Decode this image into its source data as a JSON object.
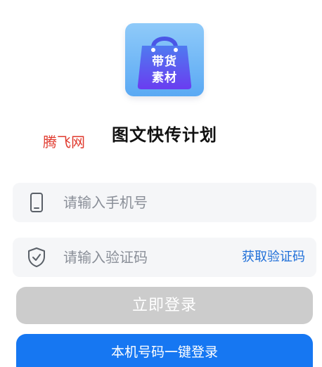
{
  "logo": {
    "line1": "带货",
    "line2": "素材"
  },
  "app_title": "图文快传计划",
  "watermark": "腾飞网",
  "phone_field": {
    "placeholder": "请输入手机号",
    "value": ""
  },
  "code_field": {
    "placeholder": "请输入验证码",
    "value": "",
    "get_code_label": "获取验证码"
  },
  "buttons": {
    "login_label": "立即登录",
    "onekey_label": "本机号码一键登录"
  },
  "colors": {
    "accent": "#1677f2",
    "link": "#1f6fd8",
    "disabled_button": "#cccccc",
    "field_bg": "#f5f6f8",
    "watermark": "#e03a2e"
  }
}
